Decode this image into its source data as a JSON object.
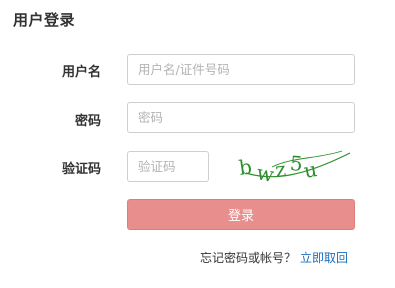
{
  "page": {
    "title": "用户登录"
  },
  "form": {
    "username_label": "用户名",
    "username_placeholder": "用户名/证件号码",
    "password_label": "密码",
    "password_placeholder": "密码",
    "captcha_label": "验证码",
    "captcha_placeholder": "验证码",
    "captcha_text": "bwz5u",
    "login_button": "登录"
  },
  "footer": {
    "forgot_text": "忘记密码或帐号？",
    "recover_link": "立即取回"
  },
  "colors": {
    "button_bg": "#e88e8c",
    "link": "#1a6fc0",
    "captcha_text": "#2d8f2d"
  }
}
